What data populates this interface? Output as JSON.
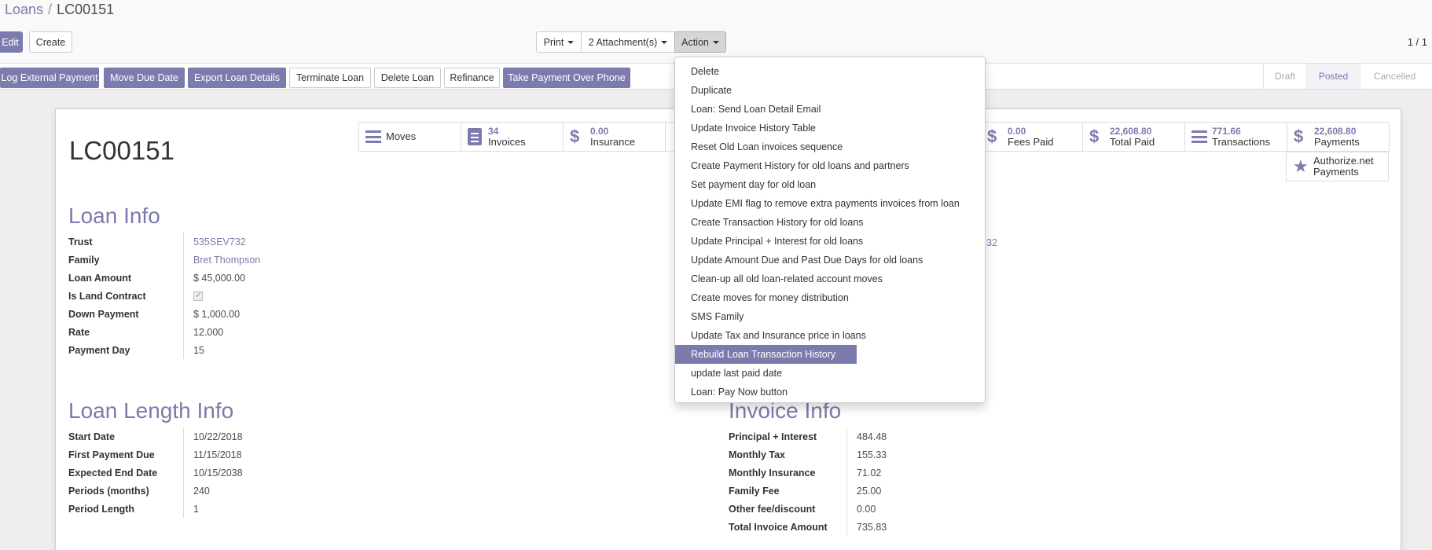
{
  "breadcrumb": {
    "parent": "Loans",
    "separator": "/",
    "current": "LC00151"
  },
  "buttons": {
    "edit": "Edit",
    "create": "Create",
    "print": "Print",
    "attachments": "2 Attachment(s)",
    "action": "Action"
  },
  "pager": "1 / 1",
  "header_buttons": [
    "Log External Payment",
    "Move Due Date",
    "Export Loan Details",
    "Terminate Loan",
    "Delete Loan",
    "Refinance",
    "Take Payment Over Phone"
  ],
  "stages": [
    "Draft",
    "Posted",
    "Cancelled"
  ],
  "record_name": "LC00151",
  "smart_buttons": {
    "moves": "Moves",
    "invoices_count": "34",
    "invoices": "Invoices",
    "insurance_value": "0.00",
    "insurance": "Insurance",
    "fees_paid_value": "0.00",
    "fees_paid": "Fees Paid",
    "total_paid_value": "22,608.80",
    "total_paid": "Total Paid",
    "transactions_value": "771.66",
    "transactions": "Transactions",
    "payments_value": "22,608.80",
    "payments": "Payments",
    "authorize_1": "Authorize.net",
    "authorize_2": "Payments"
  },
  "loan_info": {
    "title": "Loan Info",
    "rows": [
      {
        "label": "Trust",
        "value": "535SEV732"
      },
      {
        "label": "Family",
        "value": "Bret Thompson"
      },
      {
        "label": "Loan Amount",
        "value": "$ 45,000.00"
      },
      {
        "label": "Is Land Contract",
        "value": ""
      },
      {
        "label": "Down Payment",
        "value": "$ 1,000.00"
      },
      {
        "label": "Rate",
        "value": "12.000"
      },
      {
        "label": "Payment Day",
        "value": "15"
      }
    ]
  },
  "partial_right_value": "32",
  "loan_length_info": {
    "title": "Loan Length Info",
    "rows": [
      {
        "label": "Start Date",
        "value": "10/22/2018"
      },
      {
        "label": "First Payment Due",
        "value": "11/15/2018"
      },
      {
        "label": "Expected End Date",
        "value": "10/15/2038"
      },
      {
        "label": "Periods (months)",
        "value": "240"
      },
      {
        "label": "Period Length",
        "value": "1"
      }
    ]
  },
  "invoice_info": {
    "title": "Invoice Info",
    "rows": [
      {
        "label": "Principal + Interest",
        "value": "484.48"
      },
      {
        "label": "Monthly Tax",
        "value": "155.33"
      },
      {
        "label": "Monthly Insurance",
        "value": "71.02"
      },
      {
        "label": "Family Fee",
        "value": "25.00"
      },
      {
        "label": "Other fee/discount",
        "value": "0.00"
      },
      {
        "label": "Total Invoice Amount",
        "value": "735.83"
      }
    ]
  },
  "action_menu": [
    "Delete",
    "Duplicate",
    "Loan: Send Loan Detail Email",
    "Update Invoice History Table",
    "Reset Old Loan invoices sequence",
    "Create Payment History for old loans and partners",
    "Set payment day for old loan",
    "Update EMI flag to remove extra payments invoices from loan",
    "Create Transaction History for old loans",
    "Update Principal + Interest for old loans",
    "Update Amount Due and Past Due Days for old loans",
    "Clean-up all old loan-related account moves",
    "Create moves for money distribution",
    "SMS Family",
    "Update Tax and Insurance price in loans",
    "Rebuild Loan Transaction History",
    "update last paid date",
    "Loan: Pay Now button"
  ],
  "colors": {
    "accent": "#7c7bad"
  }
}
